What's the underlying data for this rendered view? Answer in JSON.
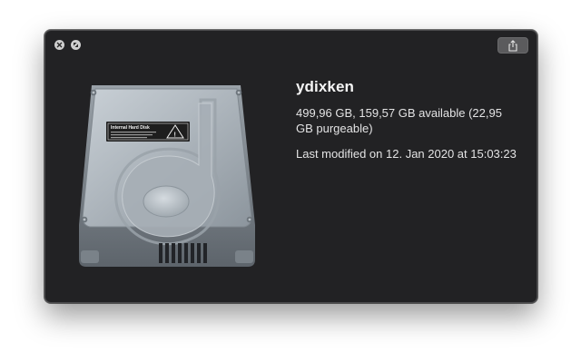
{
  "window": {
    "controls": {
      "close_icon": "close-icon",
      "zoom_icon": "fullscreen-icon"
    },
    "share_icon": "share-icon"
  },
  "preview": {
    "icon": "internal-hard-disk-icon",
    "label_plate": {
      "title": "Internal Hard Disk",
      "warning_icon": "warning-triangle-icon"
    }
  },
  "info": {
    "name": "ydixken",
    "size_text": "499,96 GB, 159,57 GB available (22,95 GB purgeable)",
    "modified_text": "Last modified on 12. Jan 2020 at 15:03:23"
  },
  "colors": {
    "window_bg": "#222224",
    "text": "#e3e3e4",
    "title_text": "#f5f5f5"
  }
}
